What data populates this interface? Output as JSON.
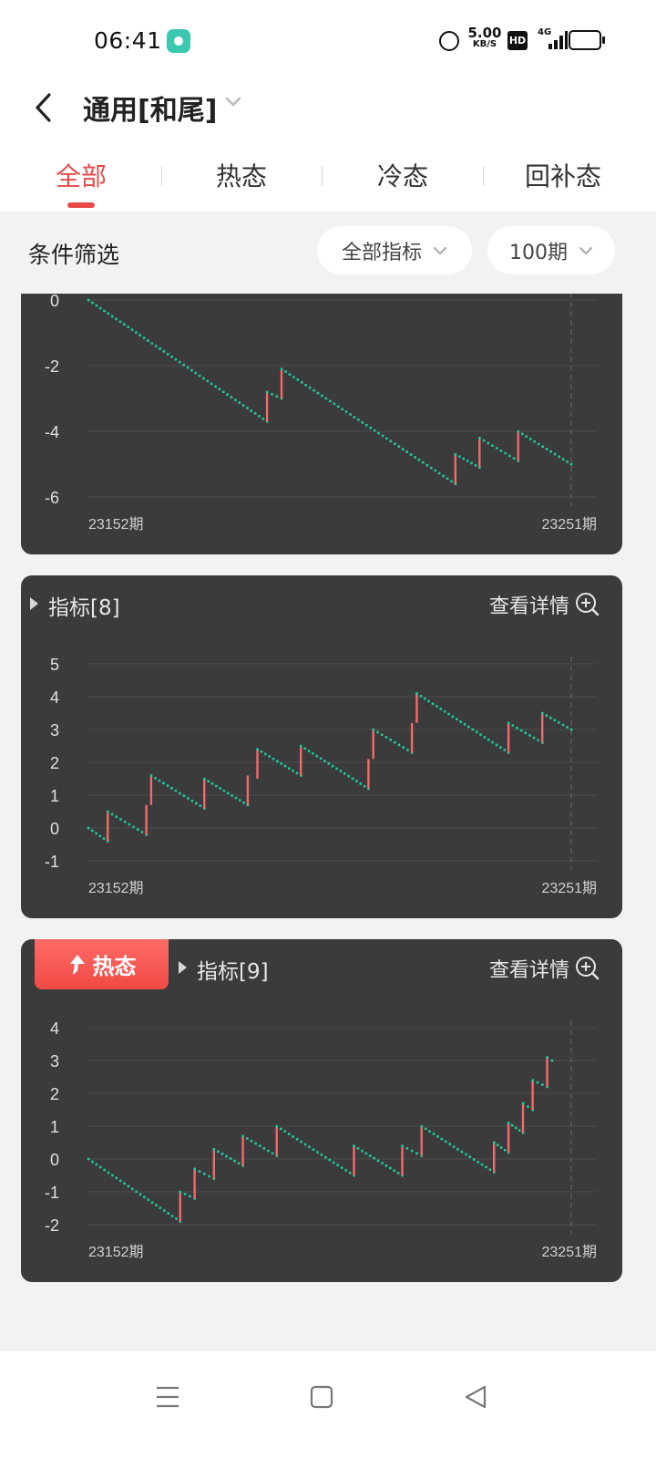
{
  "status_bar": {
    "time": "06:41",
    "net_speed": "5.00",
    "net_unit": "KB/S",
    "hd": "HD",
    "network": "4G",
    "icons": [
      "app-notification-icon",
      "alarm-icon",
      "signal-icon",
      "battery-icon"
    ]
  },
  "header": {
    "title": "通用[和尾]",
    "back_icon": "chevron-left-icon",
    "dropdown_icon": "chevron-down-icon"
  },
  "tabs": [
    {
      "label": "全部",
      "active": true
    },
    {
      "label": "热态",
      "active": false
    },
    {
      "label": "冷态",
      "active": false
    },
    {
      "label": "回补态",
      "active": false
    }
  ],
  "filters": {
    "label": "条件筛选",
    "indicator_select": "全部指标",
    "period_select": "100期"
  },
  "colors": {
    "accent": "#e84a4a",
    "card_bg": "#3b3b3b",
    "down_dots": "#1fc9a0",
    "up_bars": "#f26a6a"
  },
  "cards": [
    {
      "title": "",
      "detail_label": "",
      "badge": "",
      "chart": {
        "yticks": [
          "0",
          "-2",
          "-4",
          "-6"
        ],
        "x_start": "23152期",
        "x_end": "23251期"
      }
    },
    {
      "title": "指标[8]",
      "detail_label": "查看详情",
      "badge": "",
      "chart": {
        "yticks": [
          "5",
          "4",
          "3",
          "2",
          "1",
          "0",
          "-1"
        ],
        "x_start": "23152期",
        "x_end": "23251期"
      }
    },
    {
      "title": "指标[9]",
      "detail_label": "查看详情",
      "badge": "热态",
      "chart": {
        "yticks": [
          "4",
          "3",
          "2",
          "1",
          "0",
          "-1",
          "-2"
        ],
        "x_start": "23152期",
        "x_end": "23251期"
      }
    }
  ],
  "chart_data": [
    {
      "type": "line",
      "x_range": [
        0,
        100
      ],
      "ylim": [
        -6,
        0
      ],
      "y_ticks": [
        0,
        -2,
        -4,
        -6
      ],
      "x_labels": [
        "23152期",
        "23251期"
      ],
      "grid": true,
      "segments": [
        {
          "dir": "down",
          "x0": 0,
          "y0": 0,
          "x1": 37,
          "y1": -3.7
        },
        {
          "dir": "up",
          "x": 37,
          "from": -3.7,
          "to": -2.8
        },
        {
          "dir": "down",
          "x0": 37,
          "y0": -2.8,
          "x1": 40,
          "y1": -3.0
        },
        {
          "dir": "up",
          "x": 40,
          "from": -3.0,
          "to": -2.1
        },
        {
          "dir": "down",
          "x0": 40,
          "y0": -2.1,
          "x1": 76,
          "y1": -5.6
        },
        {
          "dir": "up",
          "x": 76,
          "from": -5.6,
          "to": -4.7
        },
        {
          "dir": "down",
          "x0": 76,
          "y0": -4.7,
          "x1": 81,
          "y1": -5.1
        },
        {
          "dir": "up",
          "x": 81,
          "from": -5.1,
          "to": -4.2
        },
        {
          "dir": "down",
          "x0": 81,
          "y0": -4.2,
          "x1": 89,
          "y1": -4.9
        },
        {
          "dir": "up",
          "x": 89,
          "from": -4.9,
          "to": -4.0
        },
        {
          "dir": "down",
          "x0": 89,
          "y0": -4.0,
          "x1": 100,
          "y1": -5.0
        }
      ]
    },
    {
      "type": "line",
      "x_range": [
        0,
        100
      ],
      "ylim": [
        -1,
        5
      ],
      "y_ticks": [
        5,
        4,
        3,
        2,
        1,
        0,
        -1
      ],
      "x_labels": [
        "23152期",
        "23251期"
      ],
      "grid": true,
      "segments": [
        {
          "dir": "down",
          "x0": 0,
          "y0": 0,
          "x1": 4,
          "y1": -0.4
        },
        {
          "dir": "up",
          "x": 4,
          "from": -0.4,
          "to": 0.5
        },
        {
          "dir": "down",
          "x0": 4,
          "y0": 0.5,
          "x1": 12,
          "y1": -0.2
        },
        {
          "dir": "up",
          "x": 12,
          "from": -0.2,
          "to": 0.7
        },
        {
          "dir": "up",
          "x": 13,
          "from": 0.7,
          "to": 1.6
        },
        {
          "dir": "down",
          "x0": 13,
          "y0": 1.6,
          "x1": 24,
          "y1": 0.6
        },
        {
          "dir": "up",
          "x": 24,
          "from": 0.6,
          "to": 1.5
        },
        {
          "dir": "down",
          "x0": 24,
          "y0": 1.5,
          "x1": 33,
          "y1": 0.7
        },
        {
          "dir": "up",
          "x": 33,
          "from": 0.7,
          "to": 1.6
        },
        {
          "dir": "up",
          "x": 35,
          "from": 1.5,
          "to": 2.4
        },
        {
          "dir": "down",
          "x0": 35,
          "y0": 2.4,
          "x1": 44,
          "y1": 1.6
        },
        {
          "dir": "up",
          "x": 44,
          "from": 1.6,
          "to": 2.5
        },
        {
          "dir": "down",
          "x0": 44,
          "y0": 2.5,
          "x1": 58,
          "y1": 1.2
        },
        {
          "dir": "up",
          "x": 58,
          "from": 1.2,
          "to": 2.1
        },
        {
          "dir": "up",
          "x": 59,
          "from": 2.1,
          "to": 3.0
        },
        {
          "dir": "down",
          "x0": 59,
          "y0": 3.0,
          "x1": 67,
          "y1": 2.3
        },
        {
          "dir": "up",
          "x": 67,
          "from": 2.3,
          "to": 3.2
        },
        {
          "dir": "up",
          "x": 68,
          "from": 3.2,
          "to": 4.1
        },
        {
          "dir": "down",
          "x0": 68,
          "y0": 4.1,
          "x1": 87,
          "y1": 2.3
        },
        {
          "dir": "up",
          "x": 87,
          "from": 2.3,
          "to": 3.2
        },
        {
          "dir": "down",
          "x0": 87,
          "y0": 3.2,
          "x1": 94,
          "y1": 2.6
        },
        {
          "dir": "up",
          "x": 94,
          "from": 2.6,
          "to": 3.5
        },
        {
          "dir": "down",
          "x0": 94,
          "y0": 3.5,
          "x1": 100,
          "y1": 3.0
        }
      ]
    },
    {
      "type": "line",
      "x_range": [
        0,
        100
      ],
      "ylim": [
        -2,
        4
      ],
      "y_ticks": [
        4,
        3,
        2,
        1,
        0,
        -1,
        -2
      ],
      "x_labels": [
        "23152期",
        "23251期"
      ],
      "grid": true,
      "segments": [
        {
          "dir": "down",
          "x0": 0,
          "y0": 0,
          "x1": 19,
          "y1": -1.9
        },
        {
          "dir": "up",
          "x": 19,
          "from": -1.9,
          "to": -1.0
        },
        {
          "dir": "down",
          "x0": 19,
          "y0": -1.0,
          "x1": 22,
          "y1": -1.2
        },
        {
          "dir": "up",
          "x": 22,
          "from": -1.2,
          "to": -0.3
        },
        {
          "dir": "down",
          "x0": 22,
          "y0": -0.3,
          "x1": 26,
          "y1": -0.6
        },
        {
          "dir": "up",
          "x": 26,
          "from": -0.6,
          "to": 0.3
        },
        {
          "dir": "down",
          "x0": 26,
          "y0": 0.3,
          "x1": 32,
          "y1": -0.2
        },
        {
          "dir": "up",
          "x": 32,
          "from": -0.2,
          "to": 0.7
        },
        {
          "dir": "down",
          "x0": 32,
          "y0": 0.7,
          "x1": 39,
          "y1": 0.1
        },
        {
          "dir": "up",
          "x": 39,
          "from": 0.1,
          "to": 1.0
        },
        {
          "dir": "down",
          "x0": 39,
          "y0": 1.0,
          "x1": 55,
          "y1": -0.5
        },
        {
          "dir": "up",
          "x": 55,
          "from": -0.5,
          "to": 0.4
        },
        {
          "dir": "down",
          "x0": 55,
          "y0": 0.4,
          "x1": 65,
          "y1": -0.5
        },
        {
          "dir": "up",
          "x": 65,
          "from": -0.5,
          "to": 0.4
        },
        {
          "dir": "down",
          "x0": 65,
          "y0": 0.4,
          "x1": 69,
          "y1": 0.1
        },
        {
          "dir": "up",
          "x": 69,
          "from": 0.1,
          "to": 1.0
        },
        {
          "dir": "down",
          "x0": 69,
          "y0": 1.0,
          "x1": 84,
          "y1": -0.4
        },
        {
          "dir": "up",
          "x": 84,
          "from": -0.4,
          "to": 0.5
        },
        {
          "dir": "down",
          "x0": 84,
          "y0": 0.5,
          "x1": 87,
          "y1": 0.2
        },
        {
          "dir": "up",
          "x": 87,
          "from": 0.2,
          "to": 1.1
        },
        {
          "dir": "down",
          "x0": 87,
          "y0": 1.1,
          "x1": 90,
          "y1": 0.8
        },
        {
          "dir": "up",
          "x": 90,
          "from": 0.8,
          "to": 1.7
        },
        {
          "dir": "down",
          "x0": 90,
          "y0": 1.7,
          "x1": 92,
          "y1": 1.5
        },
        {
          "dir": "up",
          "x": 92,
          "from": 1.5,
          "to": 2.4
        },
        {
          "dir": "down",
          "x0": 92,
          "y0": 2.4,
          "x1": 95,
          "y1": 2.2
        },
        {
          "dir": "up",
          "x": 95,
          "from": 2.2,
          "to": 3.1
        },
        {
          "dir": "down",
          "x0": 95,
          "y0": 3.1,
          "x1": 96,
          "y1": 3.0
        }
      ]
    }
  ],
  "navbar": {
    "icons": [
      "menu-icon",
      "home-icon",
      "back-icon"
    ]
  }
}
